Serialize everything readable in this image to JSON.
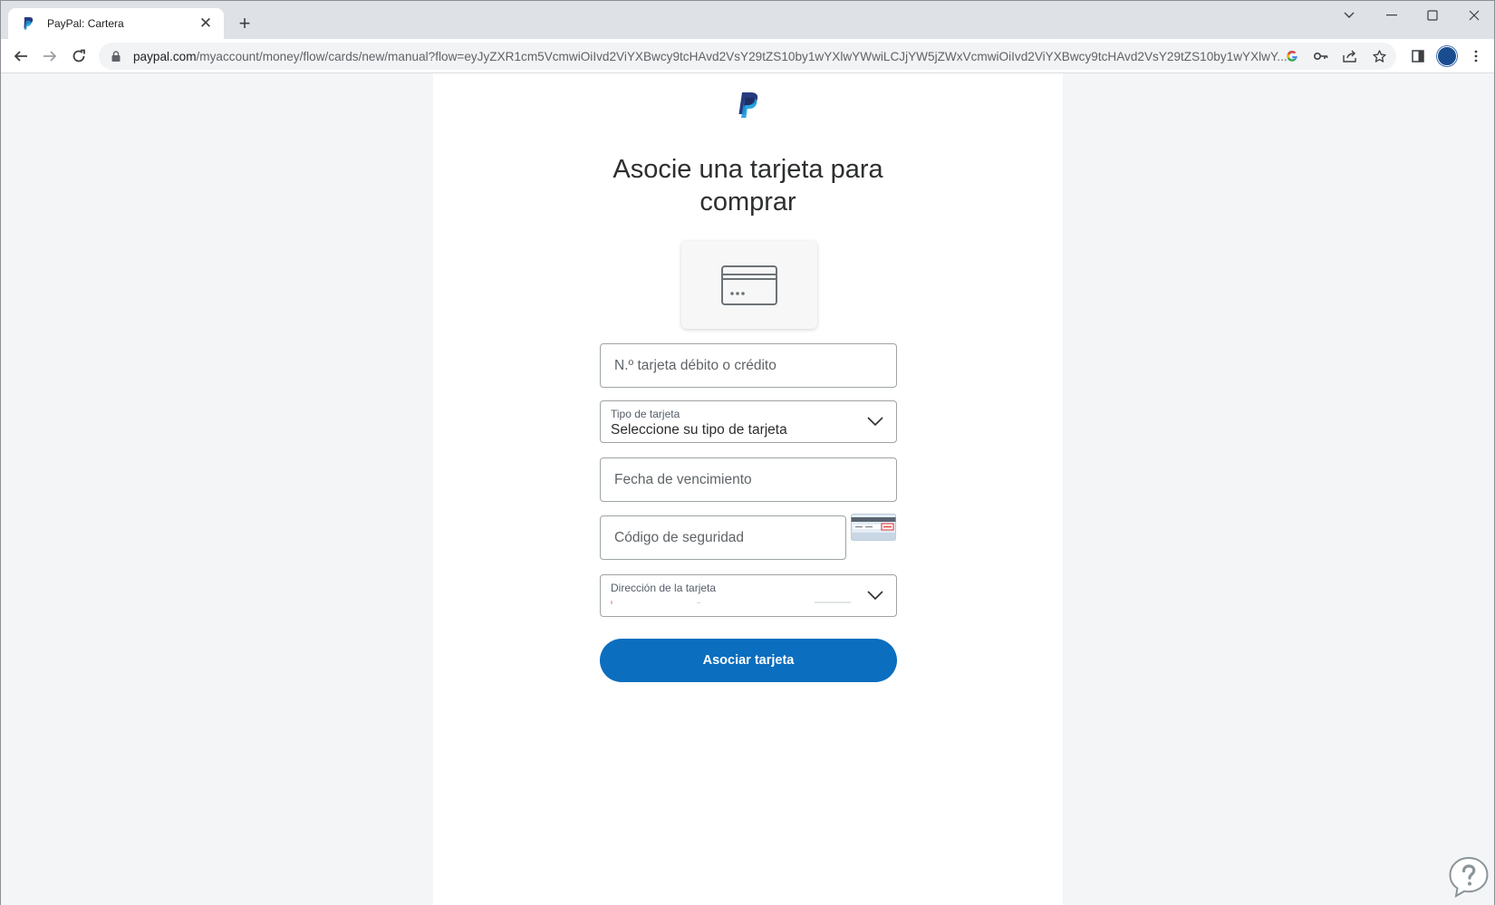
{
  "browser": {
    "tab": {
      "title": "PayPal: Cartera"
    },
    "address_bar": {
      "host": "paypal.com",
      "path": "/myaccount/money/flow/cards/new/manual?flow=eyJyZXR1cm5VcmwiOiIvd2ViYXBwcy9tcHAvd2VsY29tZS10by1wYXlwYWwiLCJjYW5jZWxVcmwiOiIvd2ViYXBwcy9tcHAvd2VsY29tZS10by1wYXlwY..."
    }
  },
  "page": {
    "title_line1": "Asocie una tarjeta para",
    "title_line2": "comprar",
    "form": {
      "card_number_placeholder": "N.º tarjeta débito o crédito",
      "card_type_label": "Tipo de tarjeta",
      "card_type_value": "Seleccione su tipo de tarjeta",
      "expiry_placeholder": "Fecha de vencimiento",
      "security_code_placeholder": "Código de seguridad",
      "address_label": "Dirección de la tarjeta",
      "submit_label": "Asociar tarjeta"
    }
  },
  "colors": {
    "primary_button": "#0b6ebf",
    "paypal_dark_blue": "#253b80",
    "paypal_light_blue": "#179bd7"
  }
}
